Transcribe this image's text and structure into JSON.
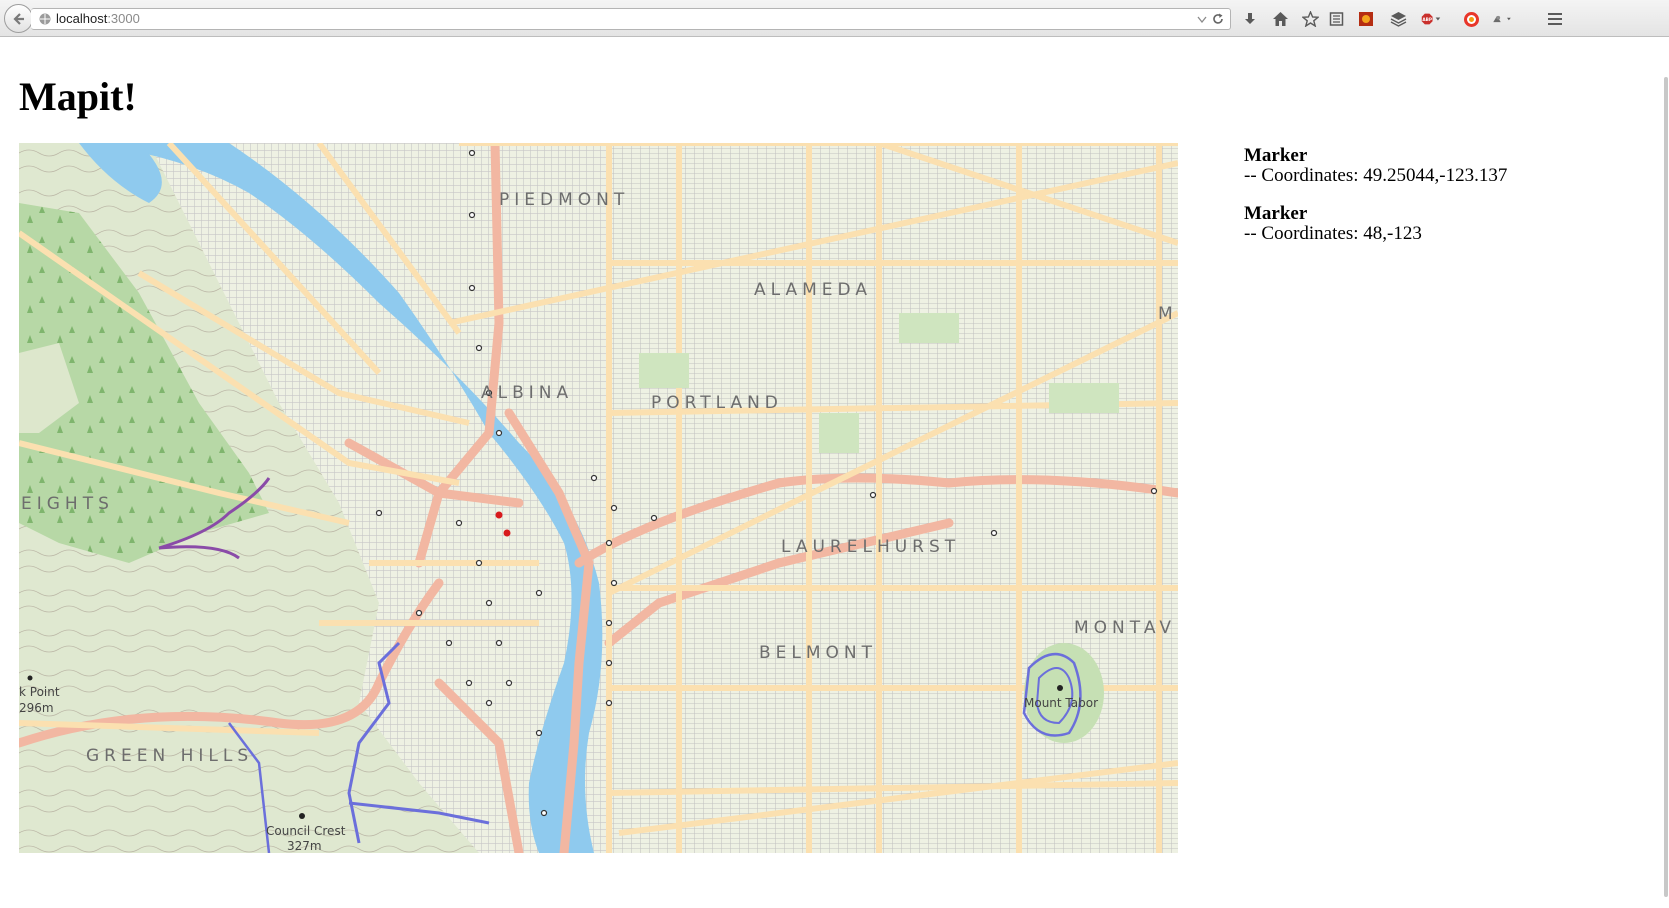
{
  "browser": {
    "url_host": "localhost",
    "url_port": ":3000"
  },
  "page": {
    "title": "Mapit!"
  },
  "map": {
    "labels": {
      "piedmont": "PIEDMONT",
      "alameda": "ALAMEDA",
      "albina": "ALBINA",
      "portland": "PORTLAND",
      "heights": "EIGHTS",
      "laurelhurst": "LAURELHURST",
      "montavilla": "MONTAV",
      "belmont": "BELMONT",
      "green_hills": "GREEN HILLS",
      "edge_m": "M"
    },
    "small_labels": {
      "point": "k Point",
      "point_elev": "296m",
      "mount_tabor": "Mount Tabor",
      "council_crest": "Council Crest",
      "council_elev": "327m"
    }
  },
  "markers": [
    {
      "name": "Marker",
      "coords": "-- Coordinates: 49.25044,-123.137"
    },
    {
      "name": "Marker",
      "coords": "-- Coordinates: 48,-123"
    }
  ]
}
